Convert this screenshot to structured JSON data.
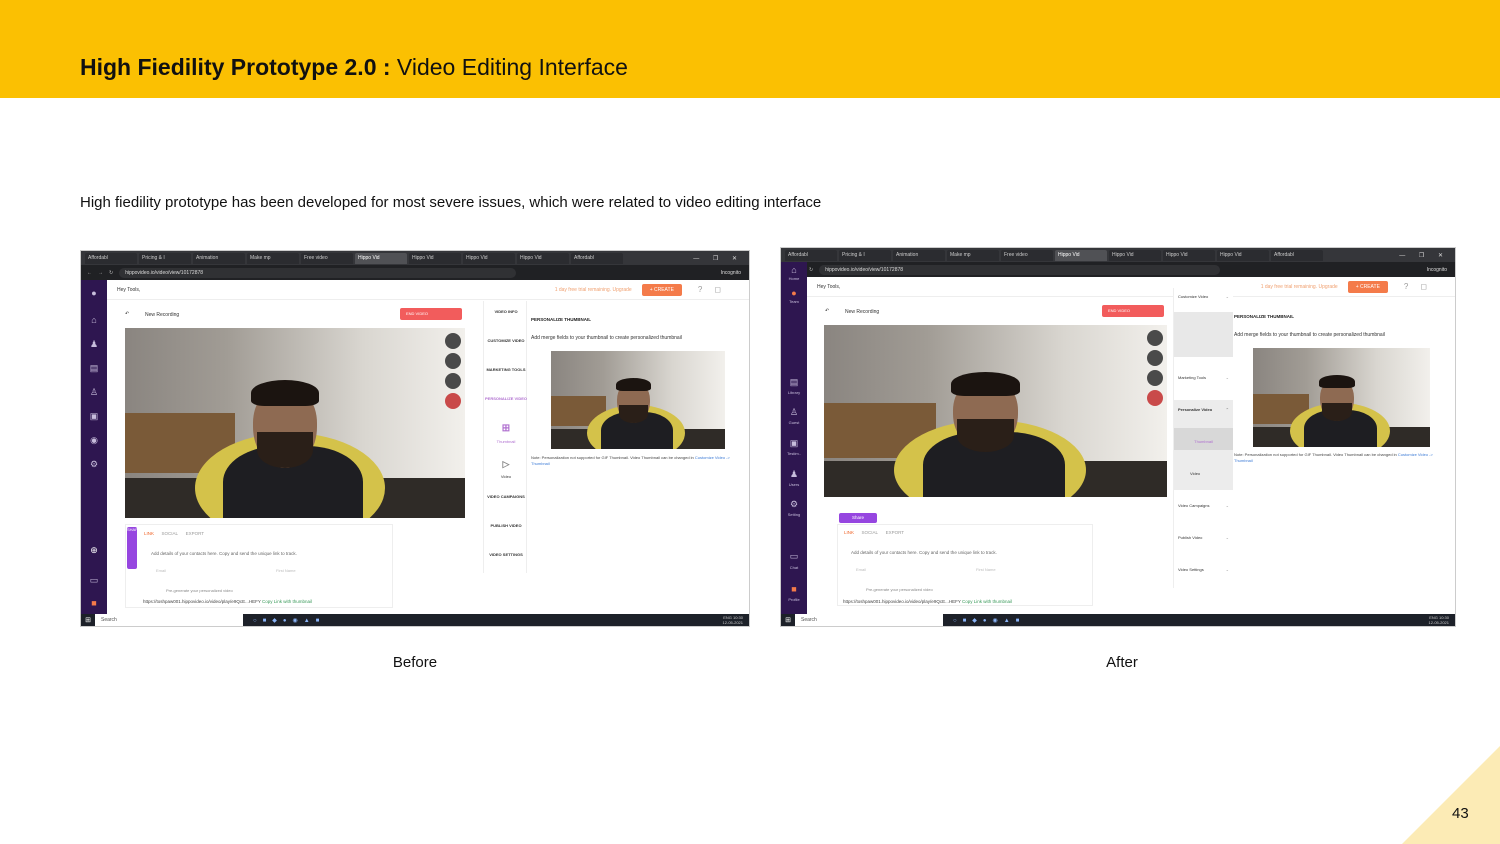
{
  "header": {
    "title_bold": "High Fiedility Prototype 2.0 :",
    "title_rest": " Video Editing Interface",
    "accent_color": "#fbc002"
  },
  "intro": "High fiedility prototype has been developed for most severe issues, which were related to video editing interface",
  "captions": {
    "before": "Before",
    "after": "After"
  },
  "page_number": "43",
  "common": {
    "tabs": [
      "Affordabl",
      "Pricing & I",
      "Animation",
      "Make mp",
      "Free video",
      "Hippo Vid",
      "Hippo Vid",
      "Hippo Vid",
      "Hippo Vid",
      "Affordabl"
    ],
    "window_controls": "— ❐ ✕",
    "url": "hippovideo.io/video/view/10172878",
    "incognito": "Incognito",
    "hey": "Hey Tools,",
    "trial": "1 day free trial remaining. Upgrade",
    "create": "+ CREATE",
    "recording": "New Recording",
    "end_video": "END VIDEO",
    "thumb_heading": "PERSONALIZE THUMBNAIL",
    "thumb_desc": "Add merge fields to your thumbnail to create personalized thumbnail",
    "thumb_note": "Note: Personalization not supported for GIF Thumbnail. Video Thumbnail can be changed in",
    "thumb_note_link": "Customize Video -> Thumbnail",
    "share_tab_link": "LINK",
    "share_tab_social": "SOCIAL",
    "share_tab_export": "EXPORT",
    "share_desc": "Add details of your contacts here. Copy and send the unique link to track.",
    "email_placeholder": "Email",
    "firstname_placeholder": "First Name",
    "pre_generate": "Pre-generate your personalized video",
    "share_link": "https://toshpaw001.hippovideo.io/video/play/e9QcE...HEFY",
    "copy_link": "Copy Link with thumbnail",
    "search": "Search",
    "lang": "ENG",
    "time": "10:30",
    "date": "12-05-2021"
  },
  "before": {
    "midnav": [
      "VIDEO INFO",
      "CUSTOMIZE VIDEO",
      "MARKETING TOOLS",
      "PERSONALIZE VIDEO",
      "Thumbnail",
      "Video",
      "VIDEO CAMPAIGNS",
      "PUBLISH VIDEO",
      "VIDEO SETTINGS"
    ],
    "share_vertical": "SHARE"
  },
  "after": {
    "leftnav": [
      "Home",
      "Team",
      "Library",
      "Guest",
      "Testim..",
      "Users",
      "Setting",
      "Chat",
      "Profile"
    ],
    "subnav": [
      "Customize Video",
      "Marketing Tools",
      "Personalize Video",
      "Thumbnail",
      "Video",
      "Video Campaigns",
      "Publish Video",
      "Video Settings"
    ],
    "share_button": "Share"
  }
}
